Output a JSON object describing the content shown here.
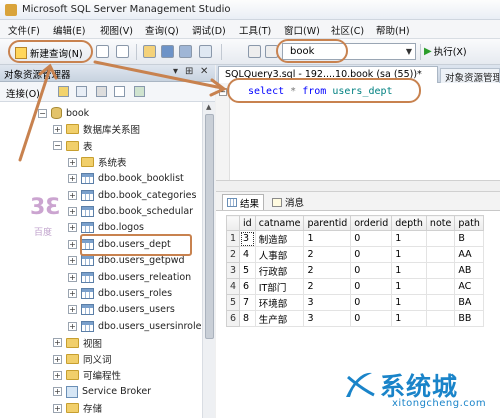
{
  "window": {
    "title": "Microsoft SQL Server Management Studio"
  },
  "menu": [
    "文件(F)",
    "编辑(E)",
    "视图(V)",
    "查询(Q)",
    "调试(D)",
    "工具(T)",
    "窗口(W)",
    "社区(C)",
    "帮助(H)"
  ],
  "toolbar": {
    "new_query_label": "新建查询(N)",
    "database_selected": "book",
    "execute_label": "执行(X)"
  },
  "object_explorer": {
    "title": "对象资源管理器",
    "pin": "▾ ⊞ ✕",
    "connect_label": "连接(O)",
    "tree": [
      {
        "label": "book",
        "icon": "database-icon",
        "expanded": true,
        "level": 0
      },
      {
        "label": "数据库关系图",
        "icon": "folder-icon",
        "expanded": false,
        "level": 1
      },
      {
        "label": "表",
        "icon": "folder-icon",
        "expanded": true,
        "level": 1
      },
      {
        "label": "系统表",
        "icon": "folder-icon",
        "expanded": false,
        "level": 2
      },
      {
        "label": "dbo.book_booklist",
        "icon": "table-icon",
        "expanded": false,
        "level": 2
      },
      {
        "label": "dbo.book_categories",
        "icon": "table-icon",
        "expanded": false,
        "level": 2
      },
      {
        "label": "dbo.book_schedular",
        "icon": "table-icon",
        "expanded": false,
        "level": 2
      },
      {
        "label": "dbo.logos",
        "icon": "table-icon",
        "expanded": false,
        "level": 2
      },
      {
        "label": "dbo.users_dept",
        "icon": "table-icon",
        "expanded": false,
        "level": 2,
        "selected": true
      },
      {
        "label": "dbo.users_getpwd",
        "icon": "table-icon",
        "expanded": false,
        "level": 2
      },
      {
        "label": "dbo.users_releation",
        "icon": "table-icon",
        "expanded": false,
        "level": 2
      },
      {
        "label": "dbo.users_roles",
        "icon": "table-icon",
        "expanded": false,
        "level": 2
      },
      {
        "label": "dbo.users_users",
        "icon": "table-icon",
        "expanded": false,
        "level": 2
      },
      {
        "label": "dbo.users_usersinrole",
        "icon": "table-icon",
        "expanded": false,
        "level": 2
      },
      {
        "label": "视图",
        "icon": "folder-icon",
        "expanded": false,
        "level": 1
      },
      {
        "label": "同义词",
        "icon": "folder-icon",
        "expanded": false,
        "level": 1
      },
      {
        "label": "可编程性",
        "icon": "folder-icon",
        "expanded": false,
        "level": 1
      },
      {
        "label": "Service Broker",
        "icon": "service-broker-icon",
        "expanded": false,
        "level": 1
      },
      {
        "label": "存储",
        "icon": "folder-icon",
        "expanded": false,
        "level": 1
      }
    ]
  },
  "logo_watermark": {
    "text": "3Ɛ",
    "caption": "百度"
  },
  "editor": {
    "tab_label": "SQLQuery3.sql - 192....10.book (sa (55))*",
    "tab2_label": "对象资源管理器",
    "sql": {
      "select": "select",
      "star": "*",
      "from": "from",
      "table": "users_dept"
    }
  },
  "results": {
    "tabs": [
      {
        "label": "结果",
        "icon": "grid-icon"
      },
      {
        "label": "消息",
        "icon": "message-icon"
      }
    ],
    "columns": [
      "",
      "id",
      "catname",
      "parentid",
      "orderid",
      "depth",
      "note",
      "path"
    ],
    "rows": [
      [
        "1",
        "3",
        "制造部",
        "1",
        "0",
        "1",
        "",
        "B"
      ],
      [
        "2",
        "4",
        "人事部",
        "2",
        "0",
        "1",
        "",
        "AA"
      ],
      [
        "3",
        "5",
        "行政部",
        "2",
        "0",
        "1",
        "",
        "AB"
      ],
      [
        "4",
        "6",
        "IT部门",
        "2",
        "0",
        "1",
        "",
        "AC"
      ],
      [
        "5",
        "7",
        "环境部",
        "3",
        "0",
        "1",
        "",
        "BA"
      ],
      [
        "6",
        "8",
        "生产部",
        "3",
        "0",
        "1",
        "",
        "BB"
      ]
    ]
  },
  "brand": {
    "name": "系统城",
    "site": "xitongcheng.com"
  },
  "colors": {
    "annotation": "#c8824f",
    "keyword": "#0000ff",
    "identifier": "#008080",
    "brand": "#1a84c9"
  }
}
